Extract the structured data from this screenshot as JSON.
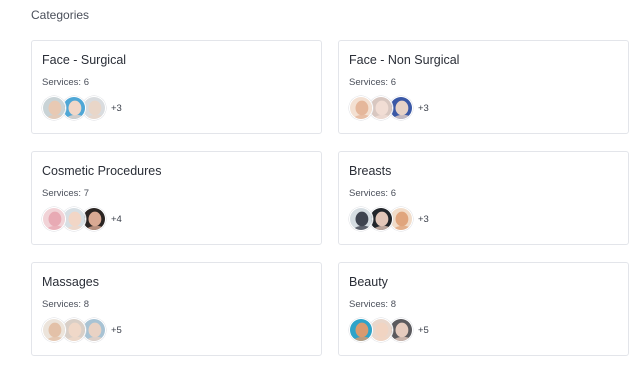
{
  "section": {
    "title": "Categories"
  },
  "services_label": "Services:",
  "categories": [
    {
      "title": "Face - Surgical",
      "services": "6",
      "more": "+3",
      "avatars": [
        {
          "icon": "face-photo-icon",
          "bg": "#c9d3d6",
          "fg": "#e8c9b3"
        },
        {
          "icon": "face-photo-icon",
          "bg": "#4fa7d6",
          "fg": "#f0d7c8"
        },
        {
          "icon": "face-photo-icon",
          "bg": "#d9dcdf",
          "fg": "#e9d6c8"
        }
      ]
    },
    {
      "title": "Face - Non Surgical",
      "services": "6",
      "more": "+3",
      "avatars": [
        {
          "icon": "face-photo-icon",
          "bg": "#f3e0d2",
          "fg": "#e5b79b"
        },
        {
          "icon": "face-photo-icon",
          "bg": "#d8c7c0",
          "fg": "#f1ddd4"
        },
        {
          "icon": "face-photo-icon",
          "bg": "#3a58a6",
          "fg": "#e6d2c7"
        }
      ]
    },
    {
      "title": "Cosmetic Procedures",
      "services": "7",
      "more": "+4",
      "avatars": [
        {
          "icon": "face-photo-icon",
          "bg": "#f1d3d7",
          "fg": "#e8aab4"
        },
        {
          "icon": "face-photo-icon",
          "bg": "#d7dfe4",
          "fg": "#f2d6c6"
        },
        {
          "icon": "face-photo-icon",
          "bg": "#2b2523",
          "fg": "#d9a993"
        }
      ]
    },
    {
      "title": "Breasts",
      "services": "6",
      "more": "+3",
      "avatars": [
        {
          "icon": "face-photo-icon",
          "bg": "#d5dde2",
          "fg": "#3e4450"
        },
        {
          "icon": "face-photo-icon",
          "bg": "#22262b",
          "fg": "#e2c6b8"
        },
        {
          "icon": "face-photo-icon",
          "bg": "#f1dcc9",
          "fg": "#e0a57d"
        }
      ]
    },
    {
      "title": "Massages",
      "services": "8",
      "more": "+5",
      "avatars": [
        {
          "icon": "face-photo-icon",
          "bg": "#ece4db",
          "fg": "#e3c1a8"
        },
        {
          "icon": "face-photo-icon",
          "bg": "#d9cfc7",
          "fg": "#f0d8c8"
        },
        {
          "icon": "face-photo-icon",
          "bg": "#a8c3d4",
          "fg": "#e9d2c4"
        }
      ]
    },
    {
      "title": "Beauty",
      "services": "8",
      "more": "+5",
      "avatars": [
        {
          "icon": "face-photo-icon",
          "bg": "#2ea3c9",
          "fg": "#d89a6f"
        },
        {
          "icon": "face-photo-icon",
          "bg": "#e9d7cc",
          "fg": "#f1d4c2"
        },
        {
          "icon": "face-photo-icon",
          "bg": "#5b5a5e",
          "fg": "#e5cbbe"
        }
      ]
    }
  ]
}
